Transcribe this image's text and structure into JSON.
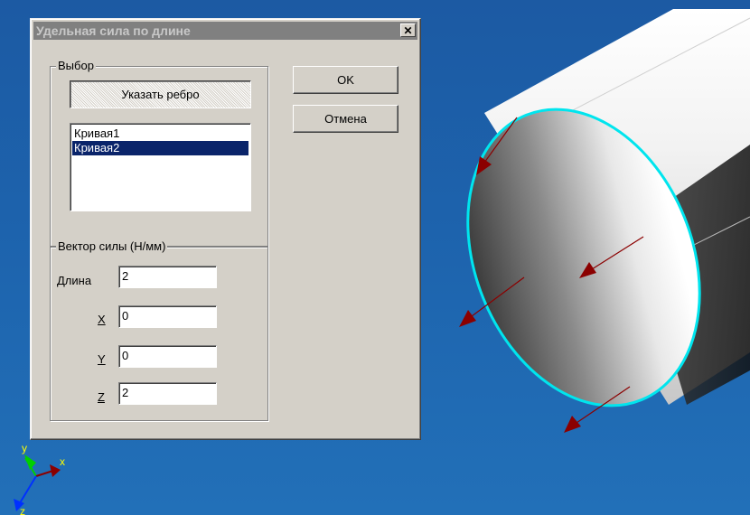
{
  "dialog": {
    "title": "Удельная сила по длине",
    "close_glyph": "✕",
    "selection_group": {
      "label": "Выбор",
      "pick_edge_button": "Указать ребро",
      "list_items": [
        "Кривая1",
        "Кривая2"
      ],
      "selected_index": 1
    },
    "ok_button": "OK",
    "cancel_button": "Отмена",
    "force_group": {
      "label": "Вектор силы (Н/мм)",
      "fields": {
        "length": {
          "label": "Длина",
          "value": "2"
        },
        "x": {
          "label": "X",
          "value": "0"
        },
        "y": {
          "label": "Y",
          "value": "0"
        },
        "z": {
          "label": "Z",
          "value": "2"
        }
      }
    }
  },
  "triad": {
    "y_label": "y",
    "x_label": "x",
    "z_label": "z"
  },
  "colors": {
    "background": "#1d63ad",
    "edge_highlight": "#00e5ee",
    "force_arrow": "#8b0000",
    "selection": "#0a246a"
  }
}
